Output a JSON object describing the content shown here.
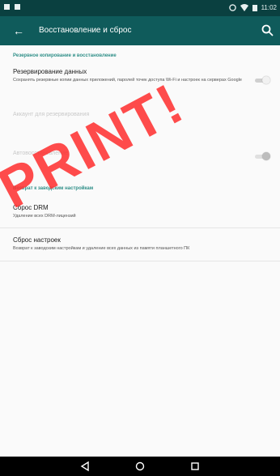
{
  "status_bar": {
    "time": "11:02"
  },
  "app_bar": {
    "title": "Восстановление и сброс",
    "back_icon": "arrow-left-icon",
    "search_icon": "search-icon"
  },
  "sections": {
    "backup": {
      "header": "Резервное копирование и восстановление",
      "item1": {
        "title": "Резервирование данных",
        "summary": "Сохранять резервные копии данных приложений, паролей точек доступа Wi-Fi и настроек на серверах Google",
        "toggle_state": "off"
      },
      "item2": {
        "title": "Аккаунт для резервирования",
        "summary": ""
      },
      "item3": {
        "title": "Автовосстановление",
        "summary": "",
        "toggle_state": "off"
      }
    },
    "reset": {
      "header": "Возврат к заводским настройкам",
      "item1": {
        "title": "Сброс DRM",
        "summary": "Удаление всех DRM-лицензий"
      },
      "item2": {
        "title": "Сброс настроек",
        "summary": "Возврат к заводским настройкам и удаление всех данных из памяти планшетного ПК"
      }
    }
  },
  "watermark": "PRINT!",
  "nav_bar": {
    "back_icon": "back-triangle-icon",
    "home_icon": "home-circle-icon",
    "recents_icon": "recents-square-icon"
  },
  "colors": {
    "status_bar": "#0a4040",
    "app_bar": "#0f5b5b",
    "accent": "#2f8f88",
    "watermark": "#ff2d2d"
  }
}
